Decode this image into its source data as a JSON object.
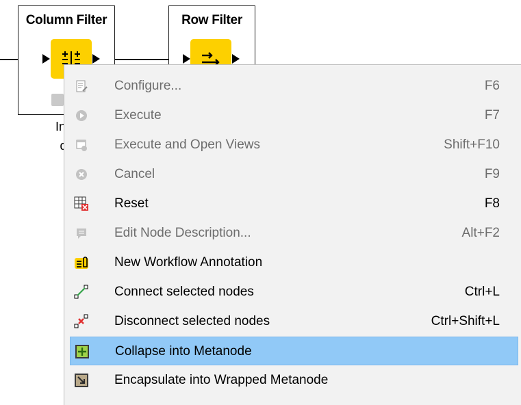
{
  "nodes": {
    "column_filter": {
      "title": "Column Filter",
      "label_line1": "Inclu",
      "label_line2": "dat"
    },
    "row_filter": {
      "title": "Row Filter"
    }
  },
  "menu": {
    "items": [
      {
        "label": "Configure...",
        "shortcut": "F6",
        "icon": "configure-icon",
        "enabled": false
      },
      {
        "label": "Execute",
        "shortcut": "F7",
        "icon": "execute-icon",
        "enabled": false
      },
      {
        "label": "Execute and Open Views",
        "shortcut": "Shift+F10",
        "icon": "execute-open-views-icon",
        "enabled": false
      },
      {
        "label": "Cancel",
        "shortcut": "F9",
        "icon": "cancel-icon",
        "enabled": false
      },
      {
        "label": "Reset",
        "shortcut": "F8",
        "icon": "reset-icon",
        "enabled": true
      },
      {
        "label": "Edit Node Description...",
        "shortcut": "Alt+F2",
        "icon": "edit-description-icon",
        "enabled": false
      },
      {
        "label": "New Workflow Annotation",
        "shortcut": "",
        "icon": "annotation-icon",
        "enabled": true
      },
      {
        "label": "Connect selected nodes",
        "shortcut": "Ctrl+L",
        "icon": "connect-nodes-icon",
        "enabled": true
      },
      {
        "label": "Disconnect selected nodes",
        "shortcut": "Ctrl+Shift+L",
        "icon": "disconnect-nodes-icon",
        "enabled": true
      },
      {
        "label": "Collapse into Metanode",
        "shortcut": "",
        "icon": "collapse-metanode-icon",
        "enabled": true,
        "highlighted": true
      },
      {
        "label": "Encapsulate into Wrapped Metanode",
        "shortcut": "",
        "icon": "wrapped-metanode-icon",
        "enabled": true
      }
    ]
  },
  "colors": {
    "node_yellow": "#fdd000",
    "menu_bg": "#f2f2f2",
    "highlight": "#91c9f7",
    "disabled_text": "#6d6d6d"
  }
}
